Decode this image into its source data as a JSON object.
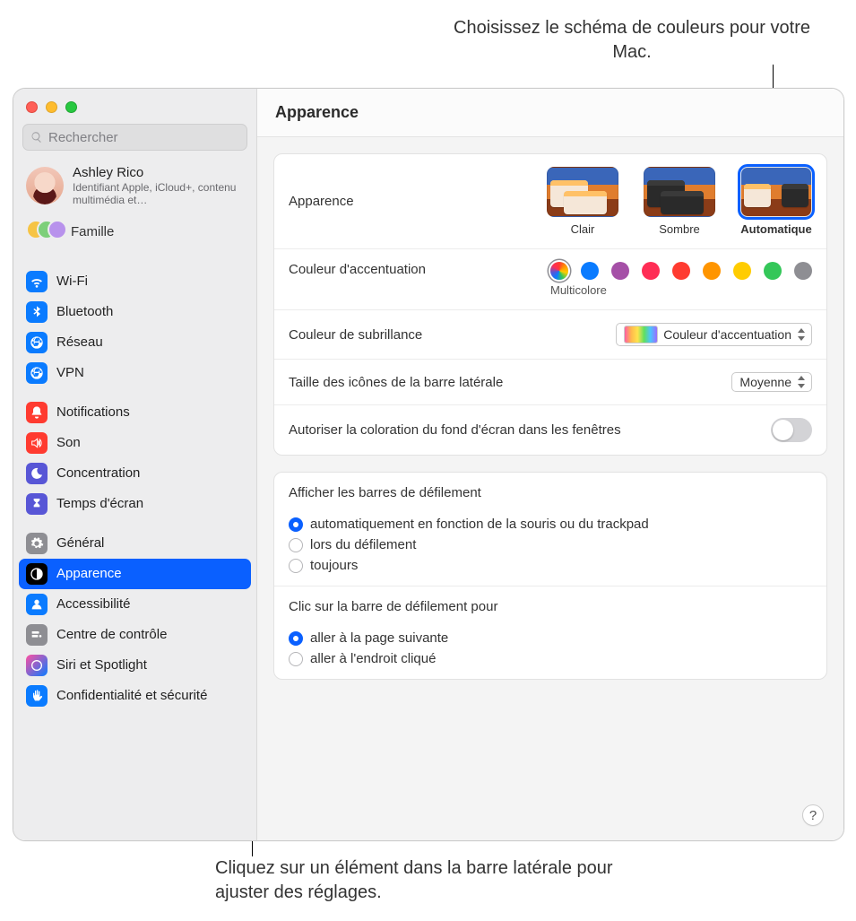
{
  "callouts": {
    "top": "Choisissez le schéma de couleurs pour votre Mac.",
    "bottom": "Cliquez sur un élément dans la barre latérale pour ajuster des réglages."
  },
  "window": {
    "title": "Apparence",
    "search_placeholder": "Rechercher",
    "account": {
      "name": "Ashley Rico",
      "sub": "Identifiant Apple, iCloud+, contenu multimédia et…"
    },
    "family_label": "Famille"
  },
  "sidebar": {
    "groups": [
      [
        {
          "id": "wifi",
          "label": "Wi-Fi",
          "icon": "wifi",
          "cls": "ic-blue"
        },
        {
          "id": "bluetooth",
          "label": "Bluetooth",
          "icon": "bluetooth",
          "cls": "ic-blue"
        },
        {
          "id": "network",
          "label": "Réseau",
          "icon": "globe",
          "cls": "ic-blue"
        },
        {
          "id": "vpn",
          "label": "VPN",
          "icon": "globe",
          "cls": "ic-blue"
        }
      ],
      [
        {
          "id": "notifications",
          "label": "Notifications",
          "icon": "bell",
          "cls": "ic-red"
        },
        {
          "id": "sound",
          "label": "Son",
          "icon": "speaker",
          "cls": "ic-red"
        },
        {
          "id": "focus",
          "label": "Concentration",
          "icon": "moon",
          "cls": "ic-purple"
        },
        {
          "id": "screentime",
          "label": "Temps d'écran",
          "icon": "hourglass",
          "cls": "ic-purple"
        }
      ],
      [
        {
          "id": "general",
          "label": "Général",
          "icon": "gear",
          "cls": "ic-gray"
        },
        {
          "id": "appearance",
          "label": "Apparence",
          "icon": "contrast",
          "cls": "ic-black",
          "selected": true
        },
        {
          "id": "accessibility",
          "label": "Accessibilité",
          "icon": "person",
          "cls": "ic-blue"
        },
        {
          "id": "controlcenter",
          "label": "Centre de contrôle",
          "icon": "switches",
          "cls": "ic-gray"
        },
        {
          "id": "siri",
          "label": "Siri et Spotlight",
          "icon": "siri",
          "cls": "ic-siri"
        },
        {
          "id": "privacy",
          "label": "Confidentialité et sécurité",
          "icon": "hand",
          "cls": "ic-blue"
        }
      ]
    ]
  },
  "settings": {
    "appearance": {
      "label": "Apparence",
      "options": [
        {
          "id": "light",
          "label": "Clair"
        },
        {
          "id": "dark",
          "label": "Sombre"
        },
        {
          "id": "auto",
          "label": "Automatique",
          "selected": true
        }
      ]
    },
    "accent": {
      "label": "Couleur d'accentuation",
      "selected_name": "Multicolore",
      "colors": [
        {
          "id": "multicolor",
          "hex": "conic",
          "selected": true
        },
        {
          "id": "blue",
          "hex": "#0a7bff"
        },
        {
          "id": "purple",
          "hex": "#a550a7"
        },
        {
          "id": "pink",
          "hex": "#ff2d55"
        },
        {
          "id": "red",
          "hex": "#ff3b30"
        },
        {
          "id": "orange",
          "hex": "#ff9500"
        },
        {
          "id": "yellow",
          "hex": "#ffcc00"
        },
        {
          "id": "green",
          "hex": "#34c759"
        },
        {
          "id": "graphite",
          "hex": "#8e8e93"
        }
      ]
    },
    "highlight": {
      "label": "Couleur de subrillance",
      "value": "Couleur d'accentuation"
    },
    "sidebar_icon_size": {
      "label": "Taille des icônes de la barre latérale",
      "value": "Moyenne"
    },
    "wallpaper_tint": {
      "label": "Autoriser la coloration du fond d'écran dans les fenêtres",
      "value": false
    },
    "scrollbars": {
      "label": "Afficher les barres de défilement",
      "options": [
        {
          "id": "auto",
          "label": "automatiquement en fonction de la souris ou du trackpad",
          "selected": true
        },
        {
          "id": "scrolling",
          "label": "lors du défilement"
        },
        {
          "id": "always",
          "label": "toujours"
        }
      ]
    },
    "scrollbar_click": {
      "label": "Clic sur la barre de défilement pour",
      "options": [
        {
          "id": "page",
          "label": "aller à la page suivante",
          "selected": true
        },
        {
          "id": "spot",
          "label": "aller à l'endroit cliqué"
        }
      ]
    }
  },
  "help": "?"
}
